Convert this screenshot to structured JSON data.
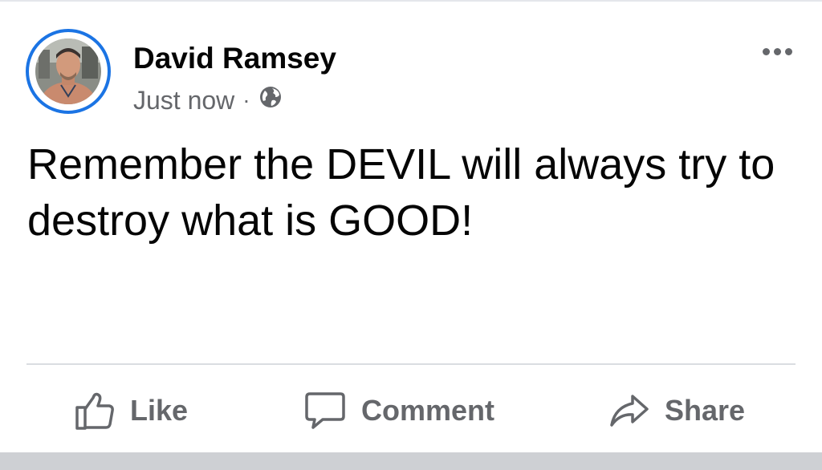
{
  "post": {
    "author": "David Ramsey",
    "timestamp": "Just now",
    "separator": "·",
    "audience_icon": "globe-icon",
    "message": "Remember the DEVIL will always try to destroy what is GOOD!"
  },
  "actions": {
    "like_label": "Like",
    "comment_label": "Comment",
    "share_label": "Share"
  },
  "colors": {
    "avatar_ring": "#1b74e4",
    "secondary_text": "#65676b",
    "primary_text": "#050505"
  }
}
